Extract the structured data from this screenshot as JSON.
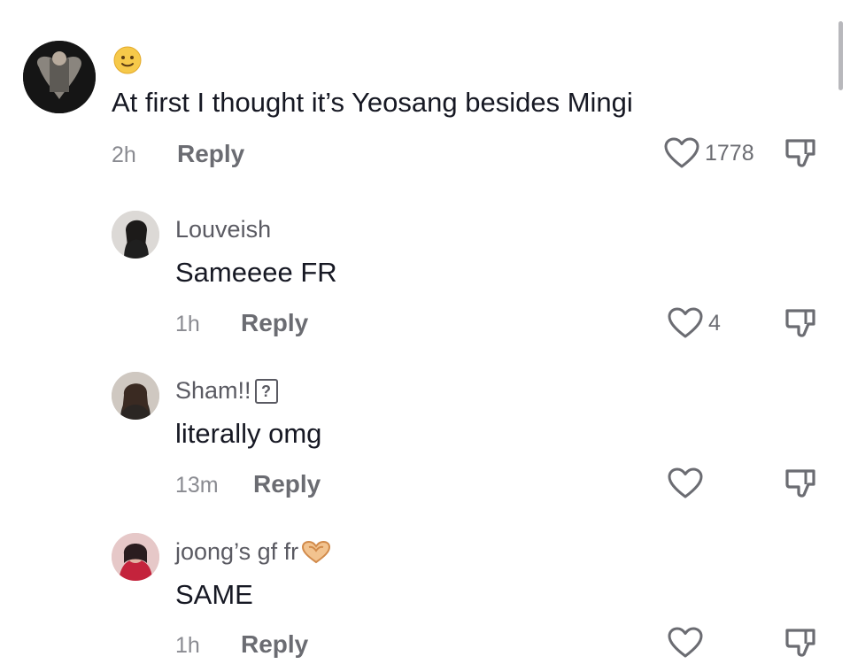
{
  "comments": [
    {
      "name": "🙂",
      "text": "At first I thought it’s Yeosang besides Mingi",
      "time": "2h",
      "reply_label": "Reply",
      "like_count": "1778"
    },
    {
      "name": "Louveish",
      "text": "Sameeee FR",
      "time": "1h",
      "reply_label": "Reply",
      "like_count": "4"
    },
    {
      "name": "Sham!!",
      "name_glyph": "?",
      "text": "literally omg",
      "time": "13m",
      "reply_label": "Reply",
      "like_count": ""
    },
    {
      "name": "joong’s gf fr",
      "text": "SAME",
      "time": "1h",
      "reply_label": "Reply",
      "like_count": ""
    }
  ],
  "colors": {
    "text": "#161823",
    "secondary": "#6b6c72",
    "muted": "#8a8b91"
  },
  "icons": [
    "heart-outline-icon",
    "thumbs-down-icon",
    "heart-hands-emoji-icon"
  ]
}
